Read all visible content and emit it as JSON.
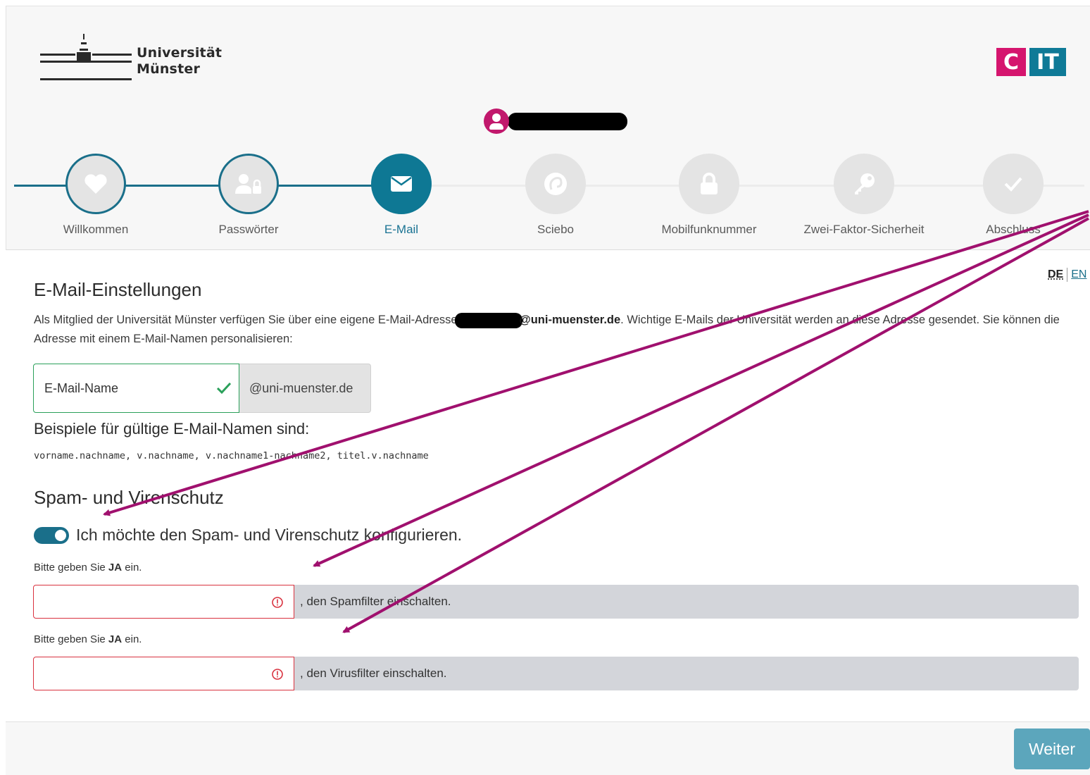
{
  "header": {
    "logo_line1": "Universität",
    "logo_line2": "Münster",
    "cit_c": "C",
    "cit_it": "IT",
    "user_icon": "user-circle-icon"
  },
  "steps": [
    {
      "label": "Willkommen",
      "icon": "heart-icon",
      "state": "done"
    },
    {
      "label": "Passwörter",
      "icon": "user-lock-icon",
      "state": "done"
    },
    {
      "label": "E-Mail",
      "icon": "envelope-icon",
      "state": "active"
    },
    {
      "label": "Sciebo",
      "icon": "sciebo-icon",
      "state": "todo"
    },
    {
      "label": "Mobilfunknummer",
      "icon": "lock-icon",
      "state": "todo"
    },
    {
      "label": "Zwei-Faktor-Sicherheit",
      "icon": "key-icon",
      "state": "todo"
    },
    {
      "label": "Abschluss",
      "icon": "check-icon",
      "state": "todo"
    }
  ],
  "lang": {
    "de": "DE",
    "en": "EN"
  },
  "email_section": {
    "title": "E-Mail-Einstellungen",
    "desc_part1": "Als Mitglied der Universität Münster verfügen Sie über eine eigene E-Mail-Adresse",
    "desc_domain": "@uni-muenster.de",
    "desc_part2": ". Wichtige E-Mails der Universität werden an diese Adresse gesendet. Sie können die Adresse mit einem E-Mail-Namen personalisieren:",
    "input_value": "E-Mail-Name",
    "suffix": "@uni-muenster.de",
    "examples_title": "Beispiele für gültige E-Mail-Namen sind:",
    "examples": "vorname.nachname, v.nachname, v.nachname1-nachname2, titel.v.nachname"
  },
  "spam_section": {
    "title": "Spam- und Virenschutz",
    "toggle_label": "Ich möchte den Spam- und Virenschutz konfigurieren.",
    "toggle_on": true,
    "prompt_prefix": "Bitte geben Sie ",
    "prompt_bold": "JA",
    "prompt_suffix": " ein.",
    "spam_suffix": ", den Spamfilter einschalten.",
    "virus_suffix": ", den Virusfilter einschalten."
  },
  "footer": {
    "next_button": "Weiter"
  },
  "colors": {
    "accent": "#0e7894",
    "brand_magenta": "#d5156e",
    "error": "#d9323f",
    "success": "#2aa05a",
    "annotation_arrow": "#a0106e"
  }
}
